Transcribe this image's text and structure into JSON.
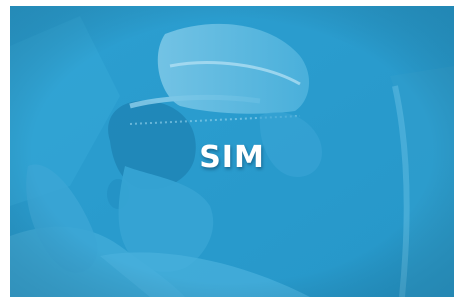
{
  "card": {
    "title": "SIM",
    "overlay_color": "#2a9ed0",
    "background_image": "person-wearing-vr-headset-photo"
  }
}
